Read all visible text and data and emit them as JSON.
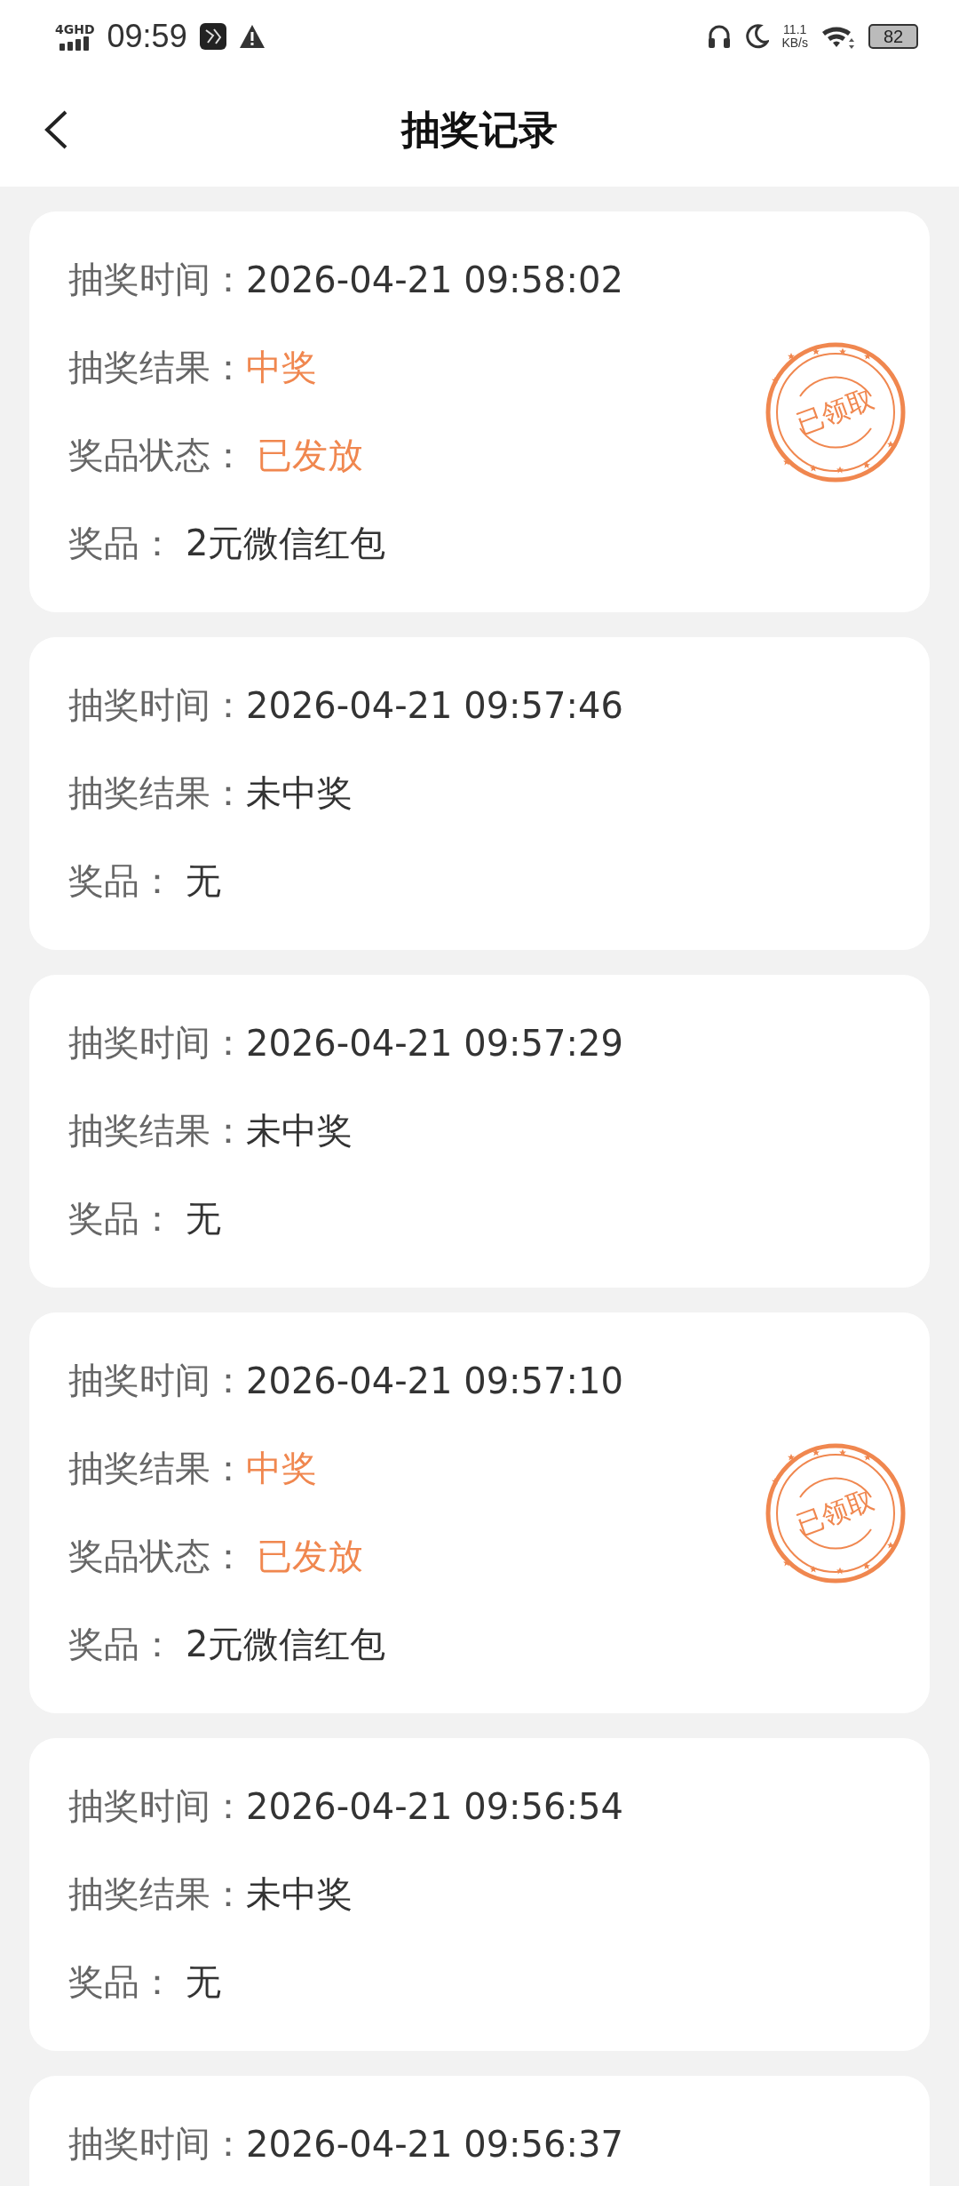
{
  "status_bar": {
    "network": "4GHD",
    "time": "09:59",
    "speed": "11.1",
    "speed_unit": "KB/s",
    "battery": "82"
  },
  "header": {
    "title": "抽奖记录"
  },
  "records": [
    {
      "kind": "won",
      "fields": [
        {
          "kind": "time",
          "label": "抽奖时间：",
          "value": "2026-04-21 09:58:02"
        },
        {
          "kind": "result",
          "label": "抽奖结果：",
          "value": "中奖"
        },
        {
          "kind": "status",
          "label": "奖品状态：",
          "value": "已发放"
        },
        {
          "kind": "prize",
          "label": "奖品：",
          "value": "2元微信红包"
        }
      ],
      "stamp": "已领取"
    },
    {
      "kind": "lost",
      "fields": [
        {
          "kind": "time",
          "label": "抽奖时间：",
          "value": "2026-04-21 09:57:46"
        },
        {
          "kind": "result",
          "label": "抽奖结果：",
          "value": "未中奖"
        },
        {
          "kind": "prize",
          "label": "奖品：",
          "value": "无"
        }
      ]
    },
    {
      "kind": "lost",
      "fields": [
        {
          "kind": "time",
          "label": "抽奖时间：",
          "value": "2026-04-21 09:57:29"
        },
        {
          "kind": "result",
          "label": "抽奖结果：",
          "value": "未中奖"
        },
        {
          "kind": "prize",
          "label": "奖品：",
          "value": "无"
        }
      ]
    },
    {
      "kind": "won",
      "fields": [
        {
          "kind": "time",
          "label": "抽奖时间：",
          "value": "2026-04-21 09:57:10"
        },
        {
          "kind": "result",
          "label": "抽奖结果：",
          "value": "中奖"
        },
        {
          "kind": "status",
          "label": "奖品状态：",
          "value": "已发放"
        },
        {
          "kind": "prize",
          "label": "奖品：",
          "value": "2元微信红包"
        }
      ],
      "stamp": "已领取"
    },
    {
      "kind": "lost",
      "fields": [
        {
          "kind": "time",
          "label": "抽奖时间：",
          "value": "2026-04-21 09:56:54"
        },
        {
          "kind": "result",
          "label": "抽奖结果：",
          "value": "未中奖"
        },
        {
          "kind": "prize",
          "label": "奖品：",
          "value": "无"
        }
      ]
    },
    {
      "kind": "lost",
      "fields": [
        {
          "kind": "time",
          "label": "抽奖时间：",
          "value": "2026-04-21 09:56:37"
        }
      ]
    }
  ]
}
